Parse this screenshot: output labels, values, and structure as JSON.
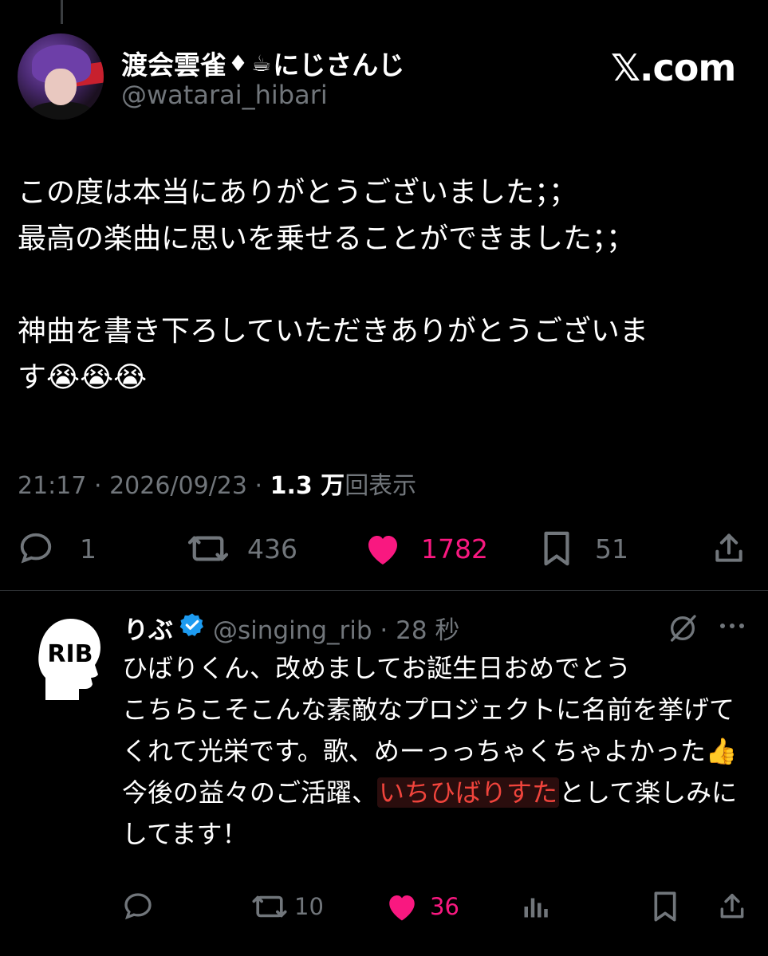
{
  "post": {
    "display_name": "渡会雲雀",
    "name_deco_1": "♦",
    "name_deco_2": "☕",
    "name_suffix": "にじさんじ",
    "handle": "@watarai_hibari",
    "site_label": "𝕏.com",
    "text": "この度は本当にありがとうございました；；\n最高の楽曲に思いを乗せることができました；；\n\n神曲を書き下ろしていただきありがとうございま\nす😭😭😭",
    "time": "21:17 · 2026/09/23 · ",
    "views_count": "1.3 万",
    "views_label": "回表示",
    "replies": "1",
    "reposts": "436",
    "likes": "1782",
    "bookmarks": "51"
  },
  "reply": {
    "display_name": "りぶ",
    "handle_time": "@singing_rib · 28 秒",
    "avatar_text": "RIB",
    "text_before": "ひばりくん、改めましてお誕生日おめでとう\nこちらこそこんな素敵なプロジェクトに名前を挙げてくれて光栄です。歌、めーっっちゃくちゃよかった👍\n今後の益々のご活躍、",
    "text_highlight": "いちひばりすた",
    "text_after": "として楽しみにしてます！",
    "reposts": "10",
    "likes": "36"
  },
  "colors": {
    "background": "#000000",
    "text": "#ffffff",
    "muted": "#71767b",
    "like": "#f91880",
    "verified": "#1d9bf0",
    "highlight": "#f0443c"
  }
}
